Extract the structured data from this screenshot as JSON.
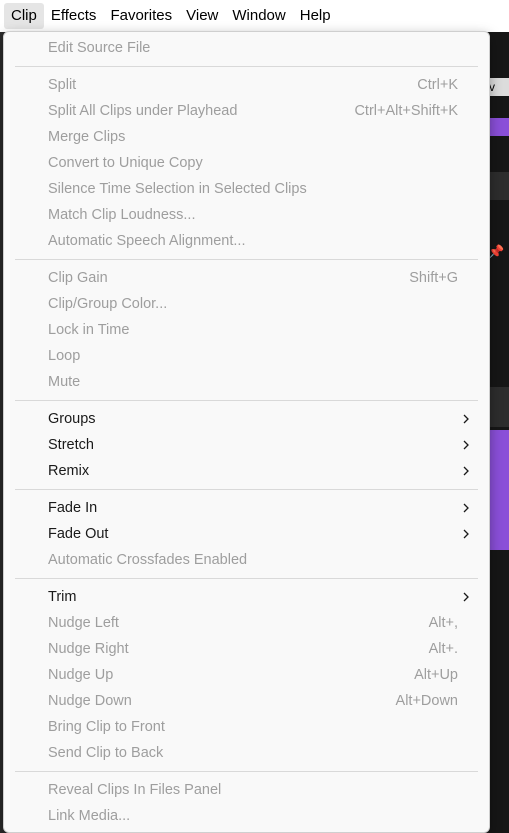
{
  "menubar": [
    "Clip",
    "Effects",
    "Favorites",
    "View",
    "Window",
    "Help"
  ],
  "menu": {
    "items": [
      {
        "label": "Edit Source File",
        "shortcut": "",
        "enabled": false,
        "submenu": false
      },
      {
        "label": "Split",
        "shortcut": "Ctrl+K",
        "enabled": false,
        "submenu": false
      },
      {
        "label": "Split All Clips under Playhead",
        "shortcut": "Ctrl+Alt+Shift+K",
        "enabled": false,
        "submenu": false
      },
      {
        "label": "Merge Clips",
        "shortcut": "",
        "enabled": false,
        "submenu": false
      },
      {
        "label": "Convert to Unique Copy",
        "shortcut": "",
        "enabled": false,
        "submenu": false
      },
      {
        "label": "Silence Time Selection in Selected Clips",
        "shortcut": "",
        "enabled": false,
        "submenu": false
      },
      {
        "label": "Match Clip Loudness...",
        "shortcut": "",
        "enabled": false,
        "submenu": false
      },
      {
        "label": "Automatic Speech Alignment...",
        "shortcut": "",
        "enabled": false,
        "submenu": false
      },
      {
        "label": "Clip Gain",
        "shortcut": "Shift+G",
        "enabled": false,
        "submenu": false
      },
      {
        "label": "Clip/Group Color...",
        "shortcut": "",
        "enabled": false,
        "submenu": false
      },
      {
        "label": "Lock in Time",
        "shortcut": "",
        "enabled": false,
        "submenu": false
      },
      {
        "label": "Loop",
        "shortcut": "",
        "enabled": false,
        "submenu": false
      },
      {
        "label": "Mute",
        "shortcut": "",
        "enabled": false,
        "submenu": false
      },
      {
        "label": "Groups",
        "shortcut": "",
        "enabled": true,
        "submenu": true
      },
      {
        "label": "Stretch",
        "shortcut": "",
        "enabled": true,
        "submenu": true
      },
      {
        "label": "Remix",
        "shortcut": "",
        "enabled": true,
        "submenu": true
      },
      {
        "label": "Fade In",
        "shortcut": "",
        "enabled": true,
        "submenu": true
      },
      {
        "label": "Fade Out",
        "shortcut": "",
        "enabled": true,
        "submenu": true
      },
      {
        "label": "Automatic Crossfades Enabled",
        "shortcut": "",
        "enabled": false,
        "submenu": false
      },
      {
        "label": "Trim",
        "shortcut": "",
        "enabled": true,
        "submenu": true
      },
      {
        "label": "Nudge Left",
        "shortcut": "Alt+,",
        "enabled": false,
        "submenu": false
      },
      {
        "label": "Nudge Right",
        "shortcut": "Alt+.",
        "enabled": false,
        "submenu": false
      },
      {
        "label": "Nudge Up",
        "shortcut": "Alt+Up",
        "enabled": false,
        "submenu": false
      },
      {
        "label": "Nudge Down",
        "shortcut": "Alt+Down",
        "enabled": false,
        "submenu": false
      },
      {
        "label": "Bring Clip to Front",
        "shortcut": "",
        "enabled": false,
        "submenu": false
      },
      {
        "label": "Send Clip to Back",
        "shortcut": "",
        "enabled": false,
        "submenu": false
      },
      {
        "label": "Reveal Clips In Files Panel",
        "shortcut": "",
        "enabled": false,
        "submenu": false
      },
      {
        "label": "Link Media...",
        "shortcut": "",
        "enabled": false,
        "submenu": false
      }
    ]
  },
  "colors": {
    "enabled_text": "#1a1a1a",
    "disabled_text": "#9e9e9e",
    "waveform": "#8a4fd8",
    "accent_pin": "#4da3ff"
  },
  "background": {
    "tab_text": "v"
  }
}
